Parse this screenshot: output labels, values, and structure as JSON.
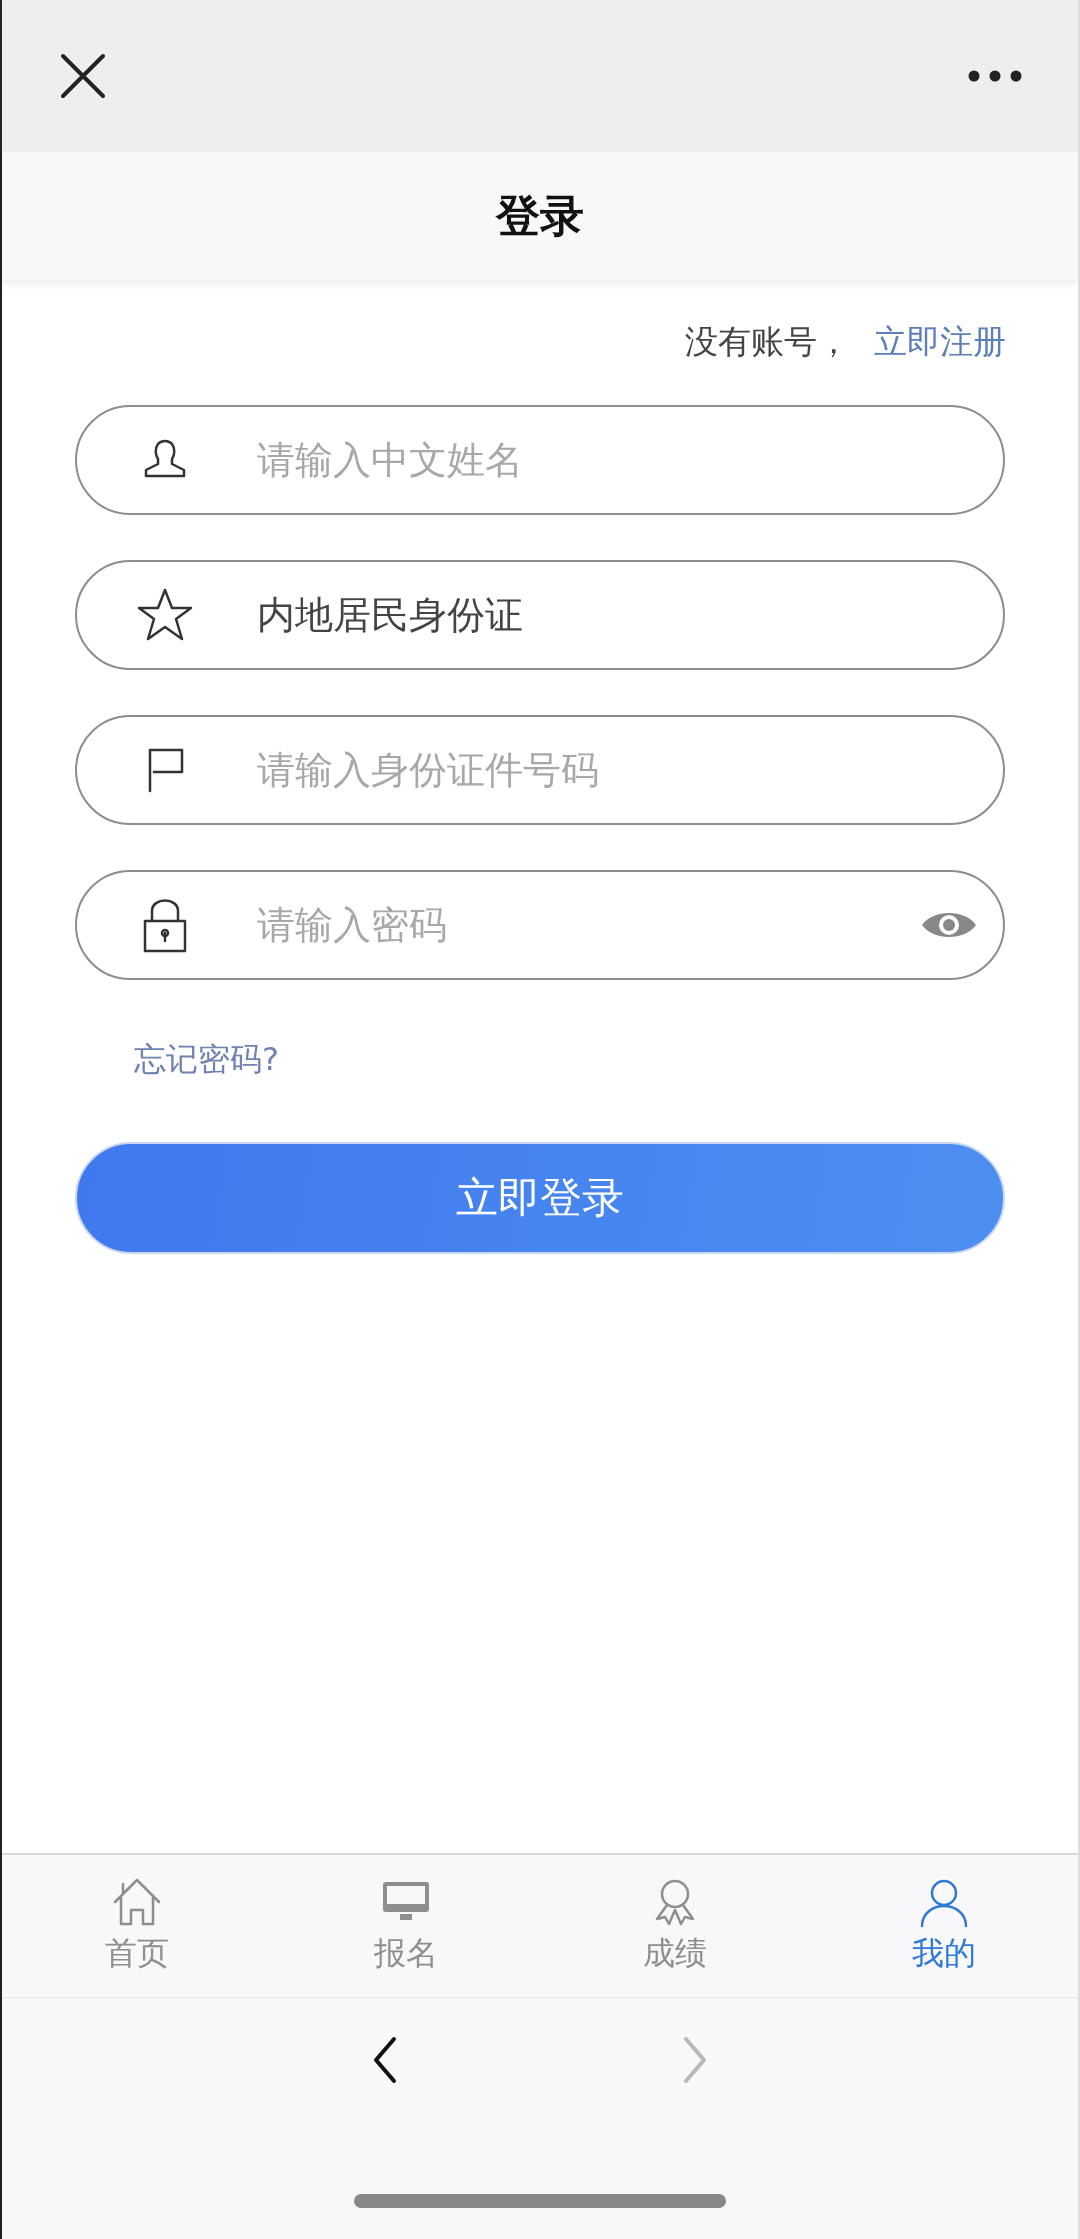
{
  "top_bar": {
    "title": "登录"
  },
  "register_prompt": {
    "text": "没有账号，",
    "link": "立即注册"
  },
  "fields": [
    {
      "kind": "person",
      "placeholder": "请输入中文姓名"
    },
    {
      "kind": "star",
      "value": "内地居民身份证"
    },
    {
      "kind": "flag",
      "placeholder": "请输入身份证件号码"
    },
    {
      "kind": "lock",
      "placeholder": "请输入密码"
    }
  ],
  "forgot_link": "忘记密码?",
  "login_button": "立即登录",
  "tabs": [
    {
      "kind": "home",
      "label": "首页",
      "selected": false
    },
    {
      "kind": "monitor",
      "label": "报名",
      "selected": false
    },
    {
      "kind": "award",
      "label": "成绩",
      "selected": false
    },
    {
      "kind": "user",
      "label": "我的",
      "selected": true
    }
  ],
  "browser_nav": [
    {
      "kind": "back",
      "disabled": false
    },
    {
      "kind": "forward",
      "disabled": true
    }
  ]
}
